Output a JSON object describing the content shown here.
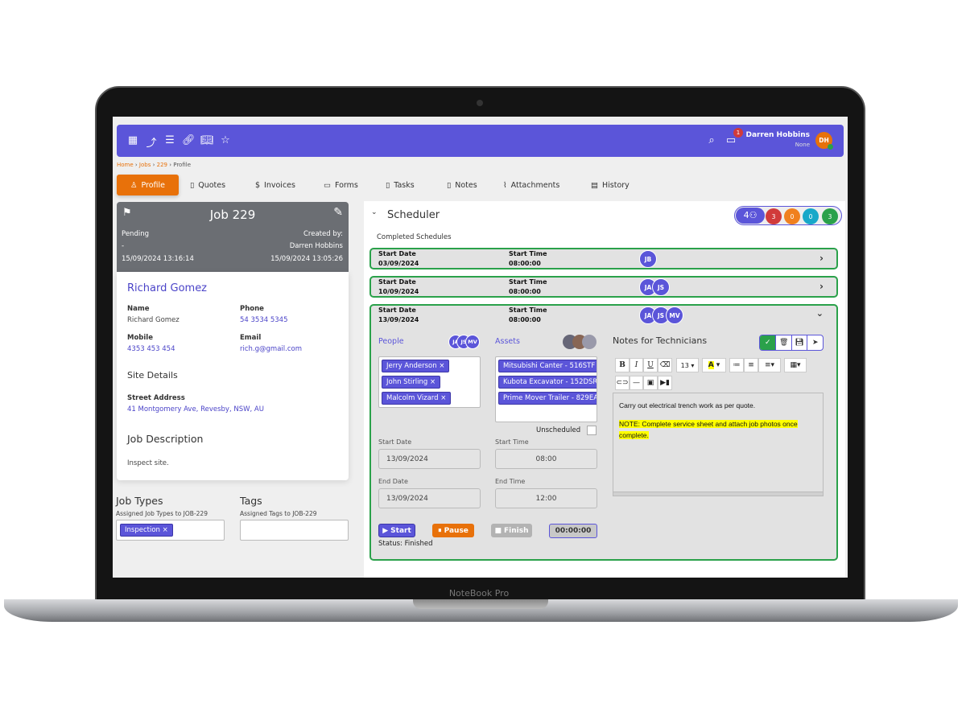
{
  "device": {
    "brand": "NoteBook Pro"
  },
  "topbar": {
    "icons": [
      "calendar-icon",
      "trend-icon",
      "list-icon",
      "link-icon",
      "book-icon",
      "star-icon"
    ],
    "user_name": "Darren Hobbins",
    "user_role": "None",
    "avatar": "DH",
    "notification_count": "1",
    "accent": "#5b55d9"
  },
  "breadcrumb": [
    "Home",
    "Jobs",
    "229",
    "Profile"
  ],
  "tabs": [
    "Profile",
    "Quotes",
    "Invoices",
    "Forms",
    "Tasks",
    "Notes",
    "Attachments",
    "History"
  ],
  "job": {
    "title": "Job 229",
    "status": "Pending",
    "dash": "-",
    "status_time": "15/09/2024 13:16:14",
    "created_by_label": "Created by:",
    "created_by": "Darren Hobbins",
    "created_time": "15/09/2024 13:05:26"
  },
  "client": {
    "name_heading": "Richard Gomez",
    "name_label": "Name",
    "name": "Richard Gomez",
    "phone_label": "Phone",
    "phone": "54 3534 5345",
    "mobile_label": "Mobile",
    "mobile": "4353 453 454",
    "email_label": "Email",
    "email": "rich.g@gmail.com"
  },
  "site": {
    "heading": "Site Details",
    "address_label": "Street Address",
    "address": "41 Montgomery Ave, Revesby, NSW, AU"
  },
  "description": {
    "heading": "Job Description",
    "text": "Inspect site."
  },
  "job_types": {
    "heading": "Job Types",
    "sub": "Assigned Job Types to JOB-229",
    "chips": [
      "Inspection"
    ]
  },
  "tags": {
    "heading": "Tags",
    "sub": "Assigned Tags to JOB-229"
  },
  "scheduler": {
    "title": "Scheduler",
    "people_count": "4",
    "counts": [
      {
        "v": "3",
        "c": "#d13b3b"
      },
      {
        "v": "0",
        "c": "#f0801f"
      },
      {
        "v": "0",
        "c": "#18a8c9"
      },
      {
        "v": "3",
        "c": "#2aa14a"
      }
    ],
    "completed_label": "Completed Schedules",
    "date_label": "Start Date",
    "time_label": "Start Time",
    "rows": [
      {
        "date": "03/09/2024",
        "time": "08:00:00",
        "people": [
          "JB"
        ]
      },
      {
        "date": "10/09/2024",
        "time": "08:00:00",
        "people": [
          "JA",
          "JS"
        ]
      },
      {
        "date": "13/09/2024",
        "time": "08:00:00",
        "people": [
          "JA",
          "JS",
          "MV"
        ]
      }
    ]
  },
  "detail": {
    "people_label": "People",
    "people_avatars": [
      "JA",
      "JS",
      "MV"
    ],
    "people": [
      "Jerry Anderson",
      "John Stirling",
      "Malcolm Vizard"
    ],
    "assets_label": "Assets",
    "assets": [
      "Mitsubishi Canter - 516STF",
      "Kubota Excavator - 152DSR",
      "Prime Mover Trailer - 829EA"
    ],
    "unscheduled_label": "Unscheduled",
    "start_date_label": "Start Date",
    "start_date": "13/09/2024",
    "start_time_label": "Start Time",
    "start_time": "08:00",
    "end_date_label": "End Date",
    "end_date": "13/09/2024",
    "end_time_label": "End Time",
    "end_time": "12:00",
    "start_btn": "Start",
    "pause_btn": "Pause",
    "finish_btn": "Finish",
    "timer": "00:00:00",
    "status": "Status: Finished",
    "notes_title": "Notes for Technicians",
    "font_size": "13",
    "note_line1": "Carry out electrical trench work as per quote.",
    "note_line2": "NOTE: Complete service sheet and attach job photos once complete."
  }
}
